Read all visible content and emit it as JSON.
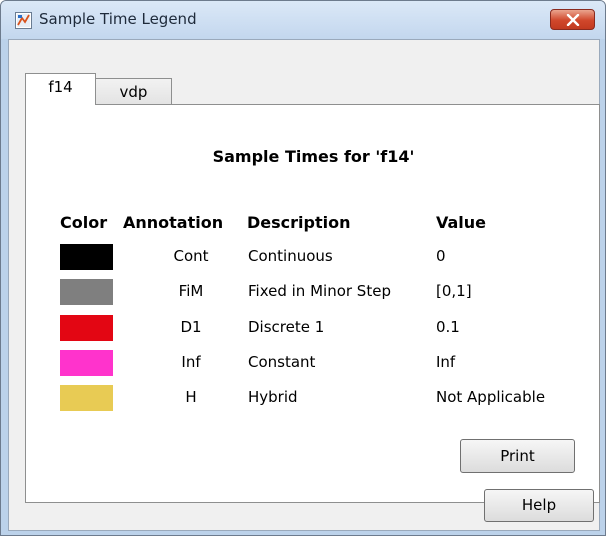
{
  "window": {
    "title": "Sample Time Legend"
  },
  "tabs": [
    {
      "label": "f14",
      "active": true
    },
    {
      "label": "vdp",
      "active": false
    }
  ],
  "panel": {
    "title": "Sample Times for 'f14'",
    "columns": {
      "color": "Color",
      "annotation": "Annotation",
      "description": "Description",
      "value": "Value"
    },
    "rows": [
      {
        "color": "#000000",
        "annotation": "Cont",
        "description": "Continuous",
        "value": "0"
      },
      {
        "color": "#7f7f7f",
        "annotation": "FiM",
        "description": "Fixed in Minor Step",
        "value": "[0,1]"
      },
      {
        "color": "#e30613",
        "annotation": "D1",
        "description": "Discrete 1",
        "value": "0.1"
      },
      {
        "color": "#ff33cc",
        "annotation": "Inf",
        "description": "Constant",
        "value": "Inf"
      },
      {
        "color": "#e8cb54",
        "annotation": "H",
        "description": "Hybrid",
        "value": "Not Applicable"
      }
    ]
  },
  "buttons": {
    "print_label": "Print",
    "help_label": "Help"
  },
  "icons": {
    "app": "matlab-figure-icon",
    "close": "close-icon"
  }
}
